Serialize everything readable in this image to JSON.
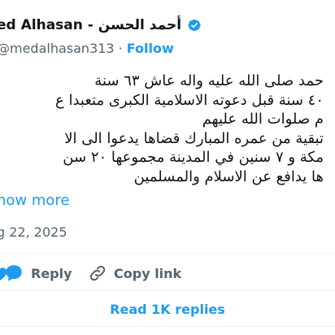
{
  "author": {
    "display_name": "ed Alhasan - أحمد الحسن",
    "handle": "medalhasan313",
    "separator": "·",
    "follow_label": "Follow",
    "verified_color": "#1d9bf0",
    "verified_icon": "verified-badge-icon"
  },
  "post": {
    "lines": [
      "حمد صلى الله عليه واله عاش ٦٣ سنة",
      "٤٠ سنة قبل دعوته الاسلامية الكبرى متعبدا ع",
      "م صلوات الله عليهم",
      "تبقية من عمره المبارك قضاها يدعوا الى الا",
      "مكة و ٧ سنين في المدينة مجموعها ٢٠ سن",
      "ها يدافع عن الاسلام والمسلمين"
    ],
    "show_more_label": "how more",
    "date": "g 22, 2025"
  },
  "actions": {
    "reply_label": "Reply",
    "copy_link_label": "Copy link"
  },
  "replies": {
    "read_label": "Read 1K replies"
  },
  "colors": {
    "accent": "#1d9bf0",
    "secondary_text": "#536471",
    "divider": "#eff3f4",
    "like": "#1d9bf0"
  }
}
